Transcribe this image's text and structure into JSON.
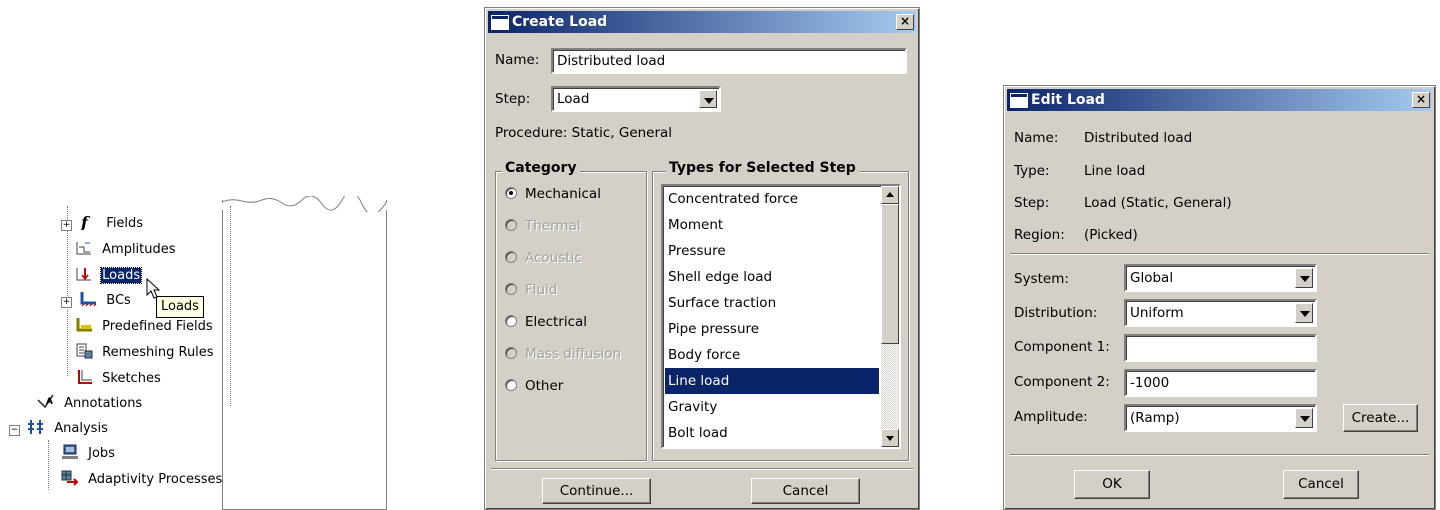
{
  "tree": {
    "items": [
      {
        "label": "Fields",
        "icon": "fields-icon"
      },
      {
        "label": "Amplitudes",
        "icon": "amplitudes-icon"
      },
      {
        "label": "Loads",
        "icon": "loads-icon"
      },
      {
        "label": "BCs",
        "icon": "bcs-icon"
      },
      {
        "label": "Predefined Fields",
        "icon": "predefined-fields-icon"
      },
      {
        "label": "Remeshing Rules",
        "icon": "remeshing-rules-icon"
      },
      {
        "label": "Sketches",
        "icon": "sketches-icon"
      },
      {
        "label": "Annotations",
        "icon": "annotations-icon"
      },
      {
        "label": "Analysis",
        "icon": "analysis-icon"
      },
      {
        "label": "Jobs",
        "icon": "jobs-icon"
      },
      {
        "label": "Adaptivity Processes",
        "icon": "adaptivity-icon"
      }
    ],
    "expand_symbol": "+",
    "collapse_symbol": "−",
    "tooltip": "Loads"
  },
  "create_load": {
    "title": "Create Load",
    "close": "×",
    "name_label": "Name:",
    "name_value": "Distributed load",
    "step_label": "Step:",
    "step_value": "Load",
    "procedure": "Procedure:  Static, General",
    "category_title": "Category",
    "categories": [
      {
        "label": "Mechanical",
        "selected": true,
        "enabled": true
      },
      {
        "label": "Thermal",
        "selected": false,
        "enabled": false
      },
      {
        "label": "Acoustic",
        "selected": false,
        "enabled": false
      },
      {
        "label": "Fluid",
        "selected": false,
        "enabled": false
      },
      {
        "label": "Electrical",
        "selected": false,
        "enabled": true
      },
      {
        "label": "Mass diffusion",
        "selected": false,
        "enabled": false
      },
      {
        "label": "Other",
        "selected": false,
        "enabled": true
      }
    ],
    "types_title": "Types for Selected Step",
    "types": [
      "Concentrated force",
      "Moment",
      "Pressure",
      "Shell edge load",
      "Surface traction",
      "Pipe pressure",
      "Body force",
      "Line load",
      "Gravity",
      "Bolt load"
    ],
    "selected_type": "Line load",
    "continue_label": "Continue...",
    "cancel_label": "Cancel"
  },
  "edit_load": {
    "title": "Edit Load",
    "close": "×",
    "info": [
      {
        "label": "Name:",
        "value": "Distributed load"
      },
      {
        "label": "Type:",
        "value": "Line load"
      },
      {
        "label": "Step:",
        "value": "Load (Static, General)"
      },
      {
        "label": "Region:",
        "value": "(Picked)"
      }
    ],
    "system_label": "System:",
    "system_value": "Global",
    "distribution_label": "Distribution:",
    "distribution_value": "Uniform",
    "component1_label": "Component 1:",
    "component1_value": "",
    "component2_label": "Component 2:",
    "component2_value": "-1000",
    "amplitude_label": "Amplitude:",
    "amplitude_value": "(Ramp)",
    "create_label": "Create...",
    "ok_label": "OK",
    "cancel_label": "Cancel"
  },
  "colors": {
    "dialog_bg": "#d4d0c8",
    "title_start": "#0a246a",
    "title_end": "#a6caf0",
    "selection": "#0a246a",
    "tooltip_bg": "#ffffe1"
  }
}
